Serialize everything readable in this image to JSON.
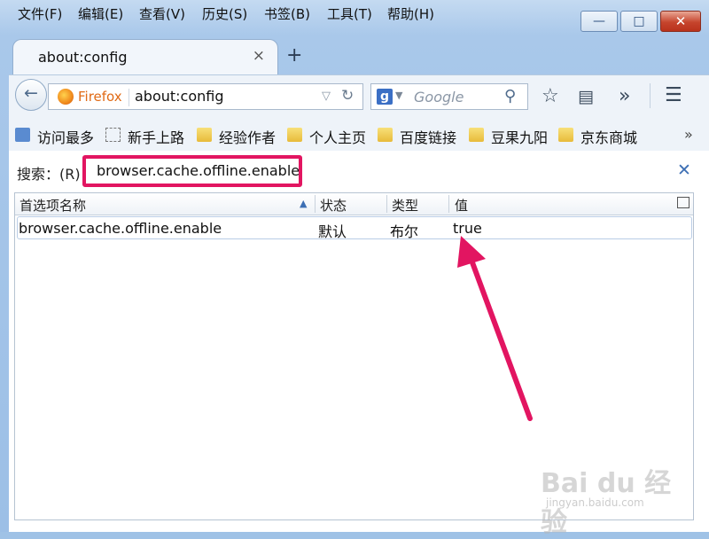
{
  "menubar": {
    "items": [
      "文件(F)",
      "编辑(E)",
      "查看(V)",
      "历史(S)",
      "书签(B)",
      "工具(T)",
      "帮助(H)"
    ]
  },
  "window_controls": {
    "minimize": "—",
    "maximize": "□",
    "close": "✕"
  },
  "tabs": [
    {
      "title": "about:config",
      "close": "×"
    }
  ],
  "new_tab": "+",
  "navbar": {
    "identity_label": "Firefox",
    "url": "about:config",
    "search_engine_icon": "g",
    "search_placeholder": "Google",
    "icons": [
      "back-arrow-icon",
      "reload-icon",
      "magnifier-icon",
      "bookmark-star-icon",
      "reading-list-icon",
      "overflow-chevrons-icon",
      "menu-hamburger-icon"
    ]
  },
  "bookmarks": [
    {
      "label": "访问最多",
      "icon": "most-visited-icon"
    },
    {
      "label": "新手上路",
      "icon": "dashed-page-icon"
    },
    {
      "label": "经验作者",
      "icon": "folder-icon"
    },
    {
      "label": "个人主页",
      "icon": "folder-icon"
    },
    {
      "label": "百度链接",
      "icon": "folder-icon"
    },
    {
      "label": "豆果九阳",
      "icon": "folder-icon"
    },
    {
      "label": "京东商城",
      "icon": "folder-icon"
    }
  ],
  "bookmarks_overflow": "»",
  "search": {
    "label": "搜索：(R)",
    "value": "browser.cache.offline.enable",
    "clear": "✕"
  },
  "table": {
    "headers": [
      "首选项名称",
      "状态",
      "类型",
      "值"
    ],
    "rows": [
      {
        "name": "browser.cache.offline.enable",
        "status": "默认",
        "type": "布尔",
        "value": "true"
      }
    ]
  },
  "annotation": {
    "color": "#e21561"
  },
  "watermark": {
    "big": "Bai du 经验",
    "small": "jingyan.baidu.com"
  }
}
